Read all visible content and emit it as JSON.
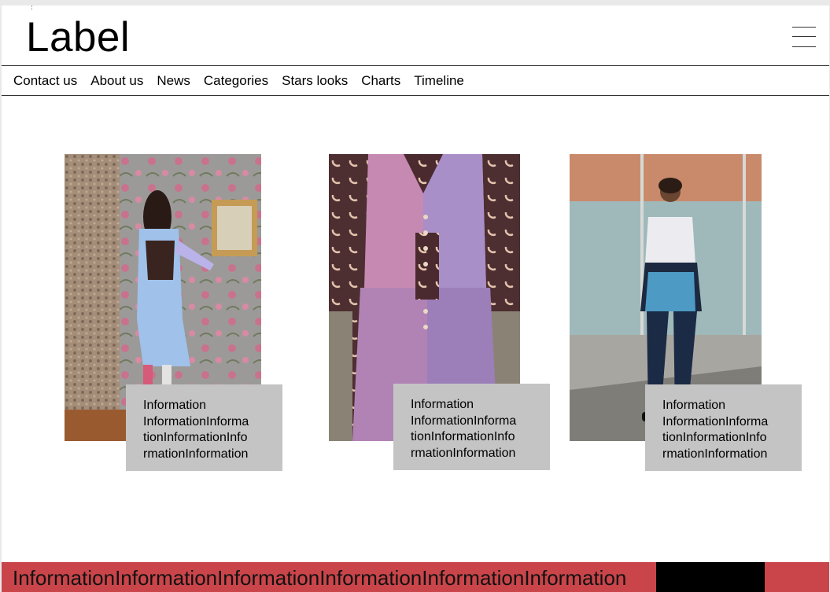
{
  "header": {
    "logo": "Label",
    "menu_icon": "hamburger-menu-icon"
  },
  "nav": {
    "items": [
      {
        "label": "Contact us"
      },
      {
        "label": "About us"
      },
      {
        "label": "News"
      },
      {
        "label": "Categories"
      },
      {
        "label": "Stars looks"
      },
      {
        "label": "Charts"
      },
      {
        "label": "Timeline"
      }
    ]
  },
  "cards": [
    {
      "image": "fashion-photo-floral-room",
      "info_lines": [
        "Information",
        "InformationInforma",
        "tionInformationInfo",
        "rmationInformation"
      ]
    },
    {
      "image": "fashion-photo-denim-vest",
      "info_lines": [
        "Information",
        "InformationInforma",
        "tionInformationInfo",
        "rmationInformation"
      ]
    },
    {
      "image": "fashion-photo-street-style",
      "info_lines": [
        "Information",
        "InformationInforma",
        "tionInformationInfo",
        "rmationInformation"
      ]
    }
  ],
  "footer": {
    "text": "InformationInformationInformationInformationInformationInformation"
  },
  "colors": {
    "footer_bg": "#c9454a",
    "footer_block": "#000000",
    "info_box_bg": "#c4c4c4"
  }
}
